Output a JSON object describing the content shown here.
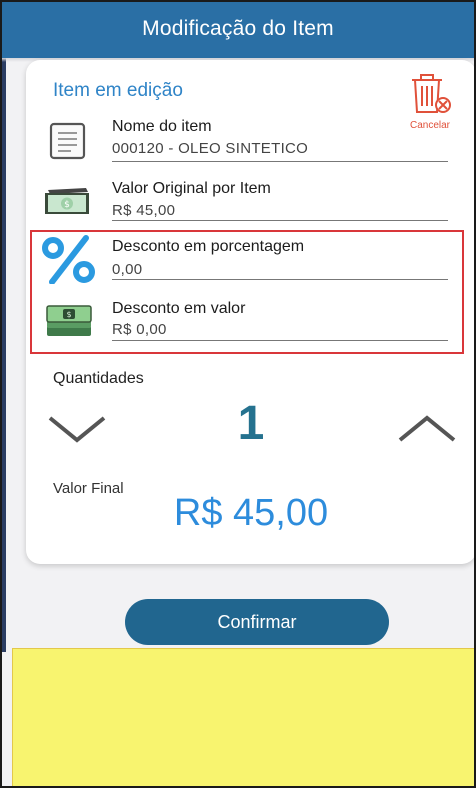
{
  "header": {
    "title": "Modificação do Item"
  },
  "card": {
    "title": "Item em edição",
    "cancel": {
      "label": "Cancelar",
      "icon": "trash-cancel-icon",
      "color": "#e0513a"
    },
    "item_name": {
      "label": "Nome do item",
      "value": "000120 - OLEO SINTETICO",
      "icon": "document-icon"
    },
    "original_value": {
      "label": "Valor Original por Item",
      "value": "R$ 45,00",
      "icon": "cash-icon"
    },
    "discount_percent": {
      "label": "Desconto em porcentagem",
      "value": "0,00",
      "icon": "percent-icon"
    },
    "discount_value": {
      "label": "Desconto em valor",
      "value": "R$ 0,00",
      "icon": "money-stack-icon"
    },
    "quantities": {
      "label": "Quantidades",
      "value": "1"
    },
    "final": {
      "label": "Valor Final",
      "value": "R$ 45,00"
    }
  },
  "confirm_label": "Confirmar",
  "colors": {
    "header": "#2a6fa5",
    "accent": "#2f84c7",
    "button": "#21668f",
    "quantity": "#25728f",
    "highlight_border": "#d9363a",
    "yellow_area": "#f8f46f"
  }
}
